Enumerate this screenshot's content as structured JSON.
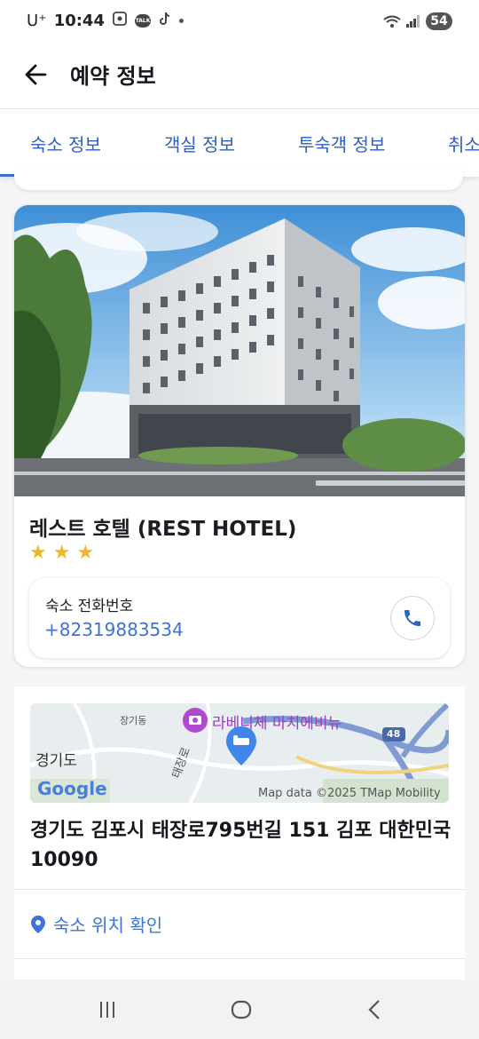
{
  "status_bar": {
    "carrier": "U⁺",
    "time": "10:44",
    "notification_icons": [
      "screenshot-icon",
      "talk-icon",
      "tiktok-icon",
      "dot-icon"
    ],
    "talk_badge": "TALK",
    "battery_level": "54"
  },
  "header": {
    "title": "예약 정보"
  },
  "tabs": [
    {
      "label": "숙소 정보",
      "active": true
    },
    {
      "label": "객실 정보",
      "active": false
    },
    {
      "label": "투숙객 정보",
      "active": false
    },
    {
      "label": "취소",
      "active": false
    }
  ],
  "hotel": {
    "name": "레스트 호텔 (REST HOTEL)",
    "star_rating": 3,
    "phone_label": "숙소 전화번호",
    "phone_number": "+82319883534"
  },
  "map": {
    "labels": {
      "janggi": "장기동",
      "poi": "라베니체 마치에비뉴",
      "gyeonggi": "경기도",
      "taejang": "태장로",
      "route": "48",
      "attribution": "Map data ©2025 TMap Mobility",
      "google": "Google"
    }
  },
  "location": {
    "address": "경기도 김포시 태장로795번길 151 김포 대한민국 10090",
    "link_label": "숙소 위치 확인"
  },
  "colors": {
    "accent": "#3d73d6",
    "star": "#f1b726",
    "poi": "#a040c8"
  }
}
